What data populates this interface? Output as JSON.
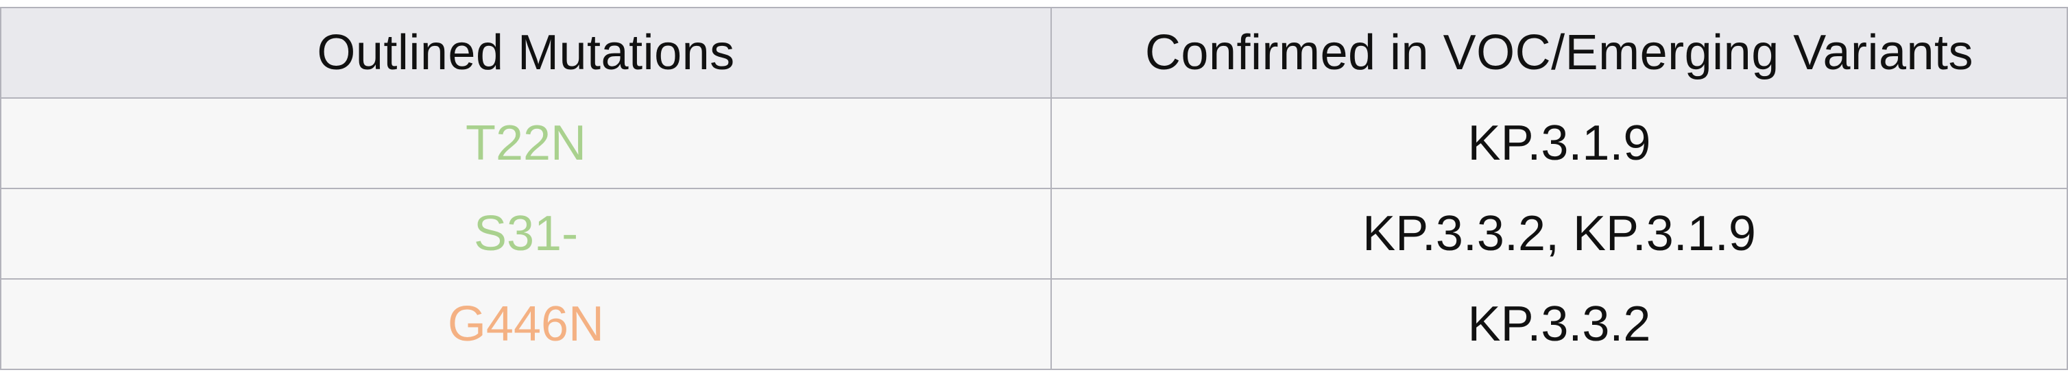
{
  "table": {
    "headers": {
      "mutations": "Outlined Mutations",
      "variants": "Confirmed in VOC/Emerging Variants"
    },
    "rows": [
      {
        "mutation": "T22N",
        "mutation_color": "#a9d18e",
        "variants": "KP.3.1.9"
      },
      {
        "mutation": "S31-",
        "mutation_color": "#a9d18e",
        "variants": "KP.3.3.2, KP.3.1.9"
      },
      {
        "mutation": "G446N",
        "mutation_color": "#f4b183",
        "variants": "KP.3.3.2"
      }
    ]
  }
}
